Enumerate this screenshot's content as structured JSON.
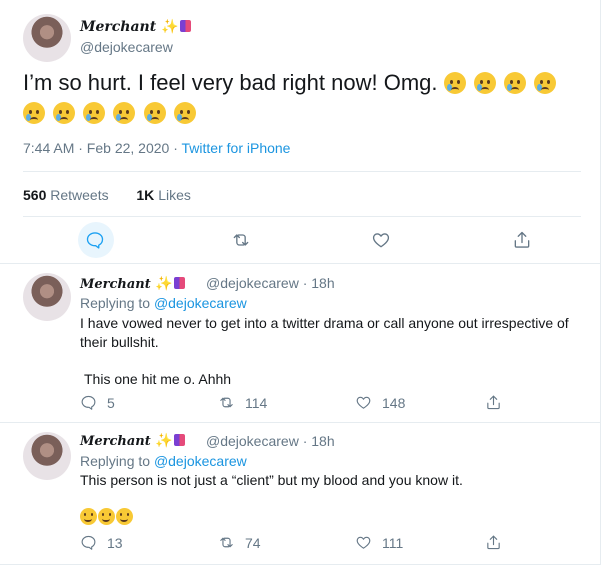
{
  "main_tweet": {
    "name": "Merchant",
    "name_emojis": "✨🛍️",
    "handle": "@dejokecarew",
    "text": "I’m so hurt. I feel very bad right now! Omg.",
    "text_emoji": "😥",
    "text_emoji_count": 10,
    "time": "7:44 AM · Feb 22, 2020",
    "separator": " · ",
    "source": "Twitter for iPhone",
    "retweets_count": "560",
    "retweets_label": "Retweets",
    "likes_count": "1K",
    "likes_label": "Likes"
  },
  "replies": [
    {
      "name": "Merchant",
      "handle_time": "@dejokecarew · 18h",
      "replying_label": "Replying to",
      "replying_to": "@dejokecarew",
      "text_lines": [
        "I have vowed never to get into a twitter drama or call anyone out irrespective of",
        "their bullshit.",
        "This one hit me o. Ahhh"
      ],
      "reply_count": "5",
      "retweet_count": "114",
      "like_count": "148"
    },
    {
      "name": "Merchant",
      "handle_time": "@dejokecarew · 18h",
      "replying_label": "Replying to",
      "replying_to": "@dejokecarew",
      "text_lines": [
        "This person is not just a “client” but my blood and you know it."
      ],
      "emoji": "🙂",
      "emoji_count": 3,
      "reply_count": "13",
      "retweet_count": "74",
      "like_count": "111"
    }
  ],
  "colors": {
    "link": "#1b95e0",
    "muted": "#657786",
    "border": "#e6ecf0",
    "reply_highlight": "#e8f5fd"
  }
}
